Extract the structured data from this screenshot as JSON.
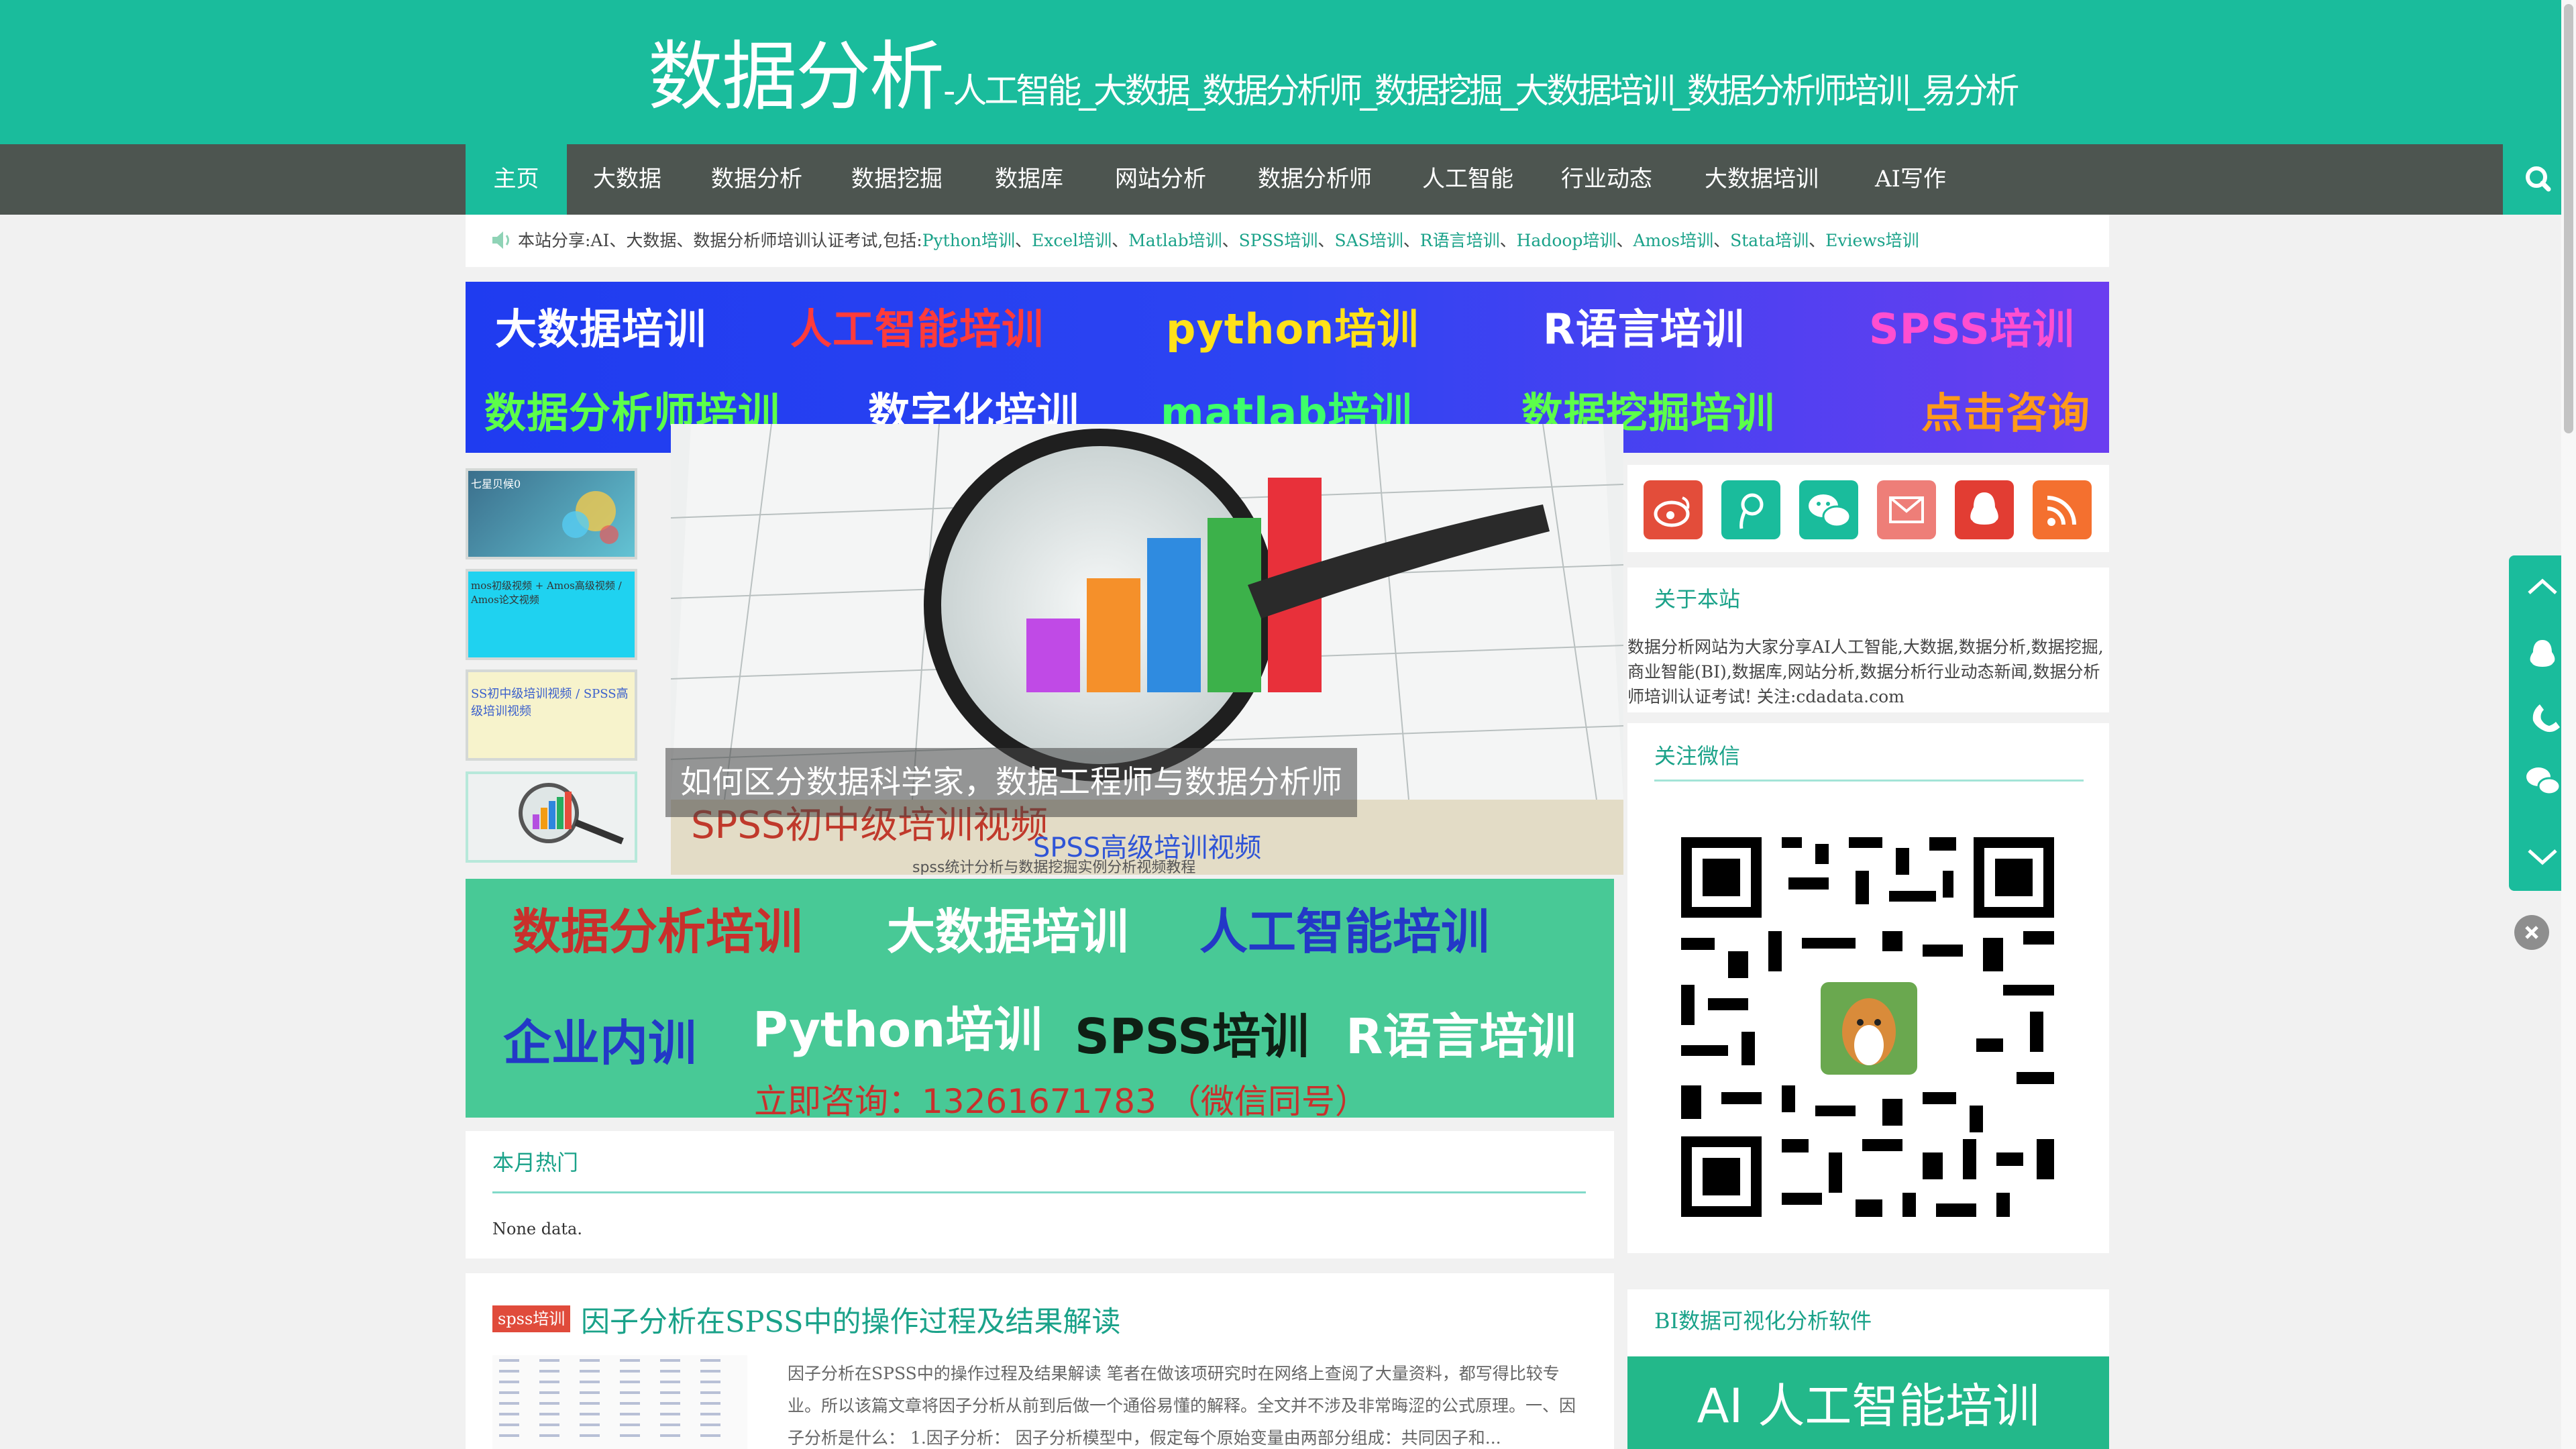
{
  "header": {
    "title": "数据分析",
    "subtitle": "-人工智能_大数据_数据分析师_数据挖掘_大数据培训_数据分析师培训_易分析"
  },
  "nav": {
    "items": [
      {
        "label": "主页"
      },
      {
        "label": "大数据"
      },
      {
        "label": "数据分析"
      },
      {
        "label": "数据挖掘"
      },
      {
        "label": "数据库"
      },
      {
        "label": "网站分析"
      },
      {
        "label": "数据分析师"
      },
      {
        "label": "人工智能"
      },
      {
        "label": "行业动态"
      },
      {
        "label": "大数据培训"
      },
      {
        "label": "AI写作"
      }
    ],
    "search_icon": "search-icon"
  },
  "notice": {
    "prefix": "本站分享:AI、大数据、数据分析师培训认证考试,包括:",
    "keywords": [
      "Python培训",
      "Excel培训",
      "Matlab培训",
      "SPSS培训",
      "SAS培训",
      "R语言培训",
      "Hadoop培训",
      "Amos培训",
      "Stata培训",
      "Eviews培训"
    ],
    "sep": "、"
  },
  "banner_top": {
    "row1": [
      "大数据培训",
      "人工智能培训",
      "python培训",
      "R语言培训",
      "SPSS培训"
    ],
    "row2": [
      "数据分析师培训",
      "数字化培训",
      "matlab培训",
      "数据挖掘培训",
      "点击咨询"
    ]
  },
  "slider": {
    "caption": "如何区分数据科学家，数据工程师与数据分析师",
    "under_text_1": "SPSS初中级培训视频",
    "under_text_2": "SPSS高级培训视频",
    "under_text_3": "spss统计分析与数据挖掘实例分析视频教程"
  },
  "thumbs": [
    {
      "text": "七星贝候0"
    },
    {
      "text": "mos初级视频 + Amos高级视频 / Amos论文视频"
    },
    {
      "text": "SS初中级培训视频 / SPSS高级培训视频"
    },
    {
      "text": ""
    }
  ],
  "banner_bottom": {
    "row1": [
      "数据分析培训",
      "大数据培训",
      "人工智能培训"
    ],
    "row2": [
      "企业内训",
      "Python培训",
      "SPSS培训",
      "R语言培训"
    ],
    "consult": "立即咨询：13261671783 （微信同号）"
  },
  "hot": {
    "title": "本月热门",
    "empty": "None data."
  },
  "article": {
    "badge": "spss培训",
    "title": "因子分析在SPSS中的操作过程及结果解读",
    "excerpt": "因子分析在SPSS中的操作过程及结果解读 笔者在做该项研究时在网络上查阅了大量资料，都写得比较专业。所以该篇文章将因子分析从前到后做一个通俗易懂的解释。全文并不涉及非常晦涩的公式原理。一、因子分析是什么： 1.因子分析： 因子分析模型中，假定每个原始变量由两部分组成：共同因子和..."
  },
  "social": {
    "icons": [
      {
        "name": "weibo-icon",
        "color": "#e34d3a"
      },
      {
        "name": "tencent-weibo-icon",
        "color": "#1abc9c"
      },
      {
        "name": "wechat-icon",
        "color": "#1abc9c"
      },
      {
        "name": "email-icon",
        "color": "#ee7e78"
      },
      {
        "name": "qq-icon",
        "color": "#e23d33"
      },
      {
        "name": "rss-icon",
        "color": "#f4702f"
      }
    ]
  },
  "about": {
    "title": "关于本站",
    "text": "数据分析网站为大家分享AI人工智能,大数据,数据分析,数据挖掘,商业智能(BI),数据库,网站分析,数据分析行业动态新闻,数据分析师培训认证考试! 关注:cdadata.com"
  },
  "wechat": {
    "title": "关注微信"
  },
  "bi": {
    "title": "BI数据可视化分析软件",
    "banner": "AI 人工智能培训"
  },
  "colors": {
    "accent": "#1abc9c",
    "nav_bg": "#4d5550",
    "link": "#1aa289"
  }
}
